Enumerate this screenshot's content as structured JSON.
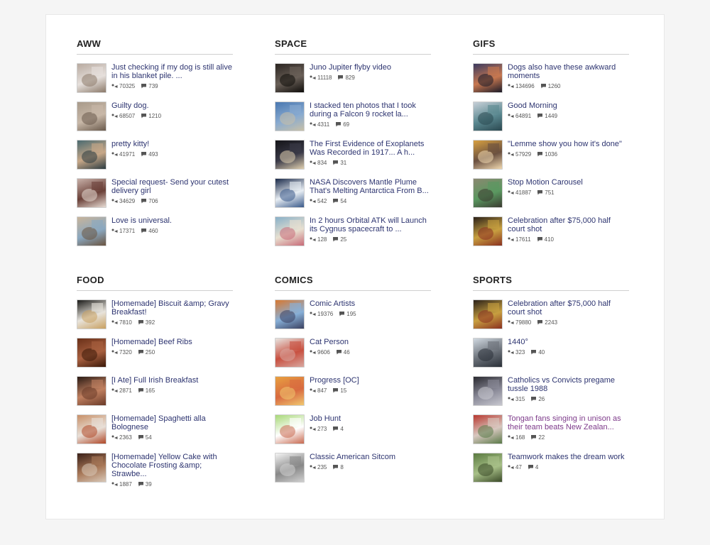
{
  "sections": [
    {
      "title": "AWW",
      "posts": [
        {
          "title": "Just checking if my dog is still alive in his blanket pile. ...",
          "score": "70325",
          "comments": "739",
          "thumb": [
            "#b8aaa0",
            "#e6e0dc",
            "#8c7a6a"
          ]
        },
        {
          "title": "Guilty dog.",
          "score": "68507",
          "comments": "1210",
          "thumb": [
            "#a89a8a",
            "#c8b8a8",
            "#6a5a4c"
          ]
        },
        {
          "title": "pretty kitty!",
          "score": "41971",
          "comments": "493",
          "thumb": [
            "#4a6a70",
            "#c8a888",
            "#2a3a40"
          ]
        },
        {
          "title": "Special request- Send your cutest delivery girl",
          "score": "34629",
          "comments": "706",
          "thumb": [
            "#c8b0a8",
            "#6a4038",
            "#e8dcd4"
          ]
        },
        {
          "title": "Love is universal.",
          "score": "17371",
          "comments": "460",
          "thumb": [
            "#c8b49a",
            "#8aa8c0",
            "#6a5440"
          ]
        }
      ]
    },
    {
      "title": "SPACE",
      "posts": [
        {
          "title": "Juno Jupiter flyby video",
          "score": "11118",
          "comments": "829",
          "thumb": [
            "#2a2420",
            "#6a6058",
            "#0e0c0a"
          ]
        },
        {
          "title": "I stacked ten photos that I took during a Falcon 9 rocket la...",
          "score": "4311",
          "comments": "69",
          "thumb": [
            "#4a78b0",
            "#88aad0",
            "#c8c0a8"
          ]
        },
        {
          "title": "The First Evidence of Exoplanets Was Recorded in 1917... A h...",
          "score": "834",
          "comments": "31",
          "thumb": [
            "#141418",
            "#3a3a48",
            "#e0d0b0"
          ]
        },
        {
          "title": "NASA Discovers Mantle Plume That's Melting Antarctica From B...",
          "score": "542",
          "comments": "54",
          "thumb": [
            "#1a2a4a",
            "#e8eef4",
            "#3a5a8a"
          ]
        },
        {
          "title": "In 2 hours Orbital ATK will Launch its Cygnus spacecraft to ...",
          "score": "128",
          "comments": "25",
          "thumb": [
            "#88b0c8",
            "#e8e0d0",
            "#c86a78"
          ]
        }
      ]
    },
    {
      "title": "GIFS",
      "posts": [
        {
          "title": "Dogs also have these awkward moments",
          "score": "134696",
          "comments": "1260",
          "thumb": [
            "#3a3a60",
            "#c87850",
            "#1a1a28"
          ]
        },
        {
          "title": "Good Morning",
          "score": "64891",
          "comments": "1449",
          "thumb": [
            "#c8d0d8",
            "#5a8890",
            "#2a4850"
          ]
        },
        {
          "title": "\"Lemme show you how it's done\"",
          "score": "57929",
          "comments": "1036",
          "thumb": [
            "#d8a040",
            "#6a5040",
            "#f0d8b0"
          ]
        },
        {
          "title": "Stop Motion Carousel",
          "score": "41887",
          "comments": "751",
          "thumb": [
            "#8a8870",
            "#5a9860",
            "#3a3a30"
          ]
        },
        {
          "title": "Celebration after $75,000 half court shot",
          "score": "17611",
          "comments": "410",
          "thumb": [
            "#2a2018",
            "#c8a040",
            "#8a3020"
          ]
        }
      ]
    },
    {
      "title": "FOOD",
      "posts": [
        {
          "title": "[Homemade] Biscuit &amp; Gravy Breakfast!",
          "score": "7810",
          "comments": "392",
          "thumb": [
            "#1a1a18",
            "#e8e4dc",
            "#c8a060"
          ]
        },
        {
          "title": "[Homemade] Beef Ribs",
          "score": "7320",
          "comments": "250",
          "thumb": [
            "#6a3018",
            "#a86040",
            "#3a1808"
          ]
        },
        {
          "title": "[I Ate] Full Irish Breakfast",
          "score": "2871",
          "comments": "165",
          "thumb": [
            "#2a1a14",
            "#c08060",
            "#6a3a28"
          ]
        },
        {
          "title": "[Homemade] Spaghetti alla Bolognese",
          "score": "2363",
          "comments": "54",
          "thumb": [
            "#c89068",
            "#e8e0d8",
            "#b04828"
          ]
        },
        {
          "title": "[Homemade] Yellow Cake with Chocolate Frosting &amp; Strawbe...",
          "score": "1887",
          "comments": "39",
          "thumb": [
            "#3a2018",
            "#a87858",
            "#d8c8b8"
          ]
        }
      ]
    },
    {
      "title": "COMICS",
      "posts": [
        {
          "title": "Comic Artists",
          "score": "19376",
          "comments": "195",
          "thumb": [
            "#d87830",
            "#88b0d8",
            "#3a4060"
          ]
        },
        {
          "title": "Cat Person",
          "score": "9606",
          "comments": "46",
          "thumb": [
            "#e8e4e0",
            "#c85040",
            "#d8a8a0"
          ]
        },
        {
          "title": "Progress [OC]",
          "score": "847",
          "comments": "15",
          "thumb": [
            "#e8a040",
            "#d86a40",
            "#f0c870"
          ]
        },
        {
          "title": "Job Hunt",
          "score": "273",
          "comments": "4",
          "thumb": [
            "#a8d878",
            "#ffffff",
            "#c86a50"
          ]
        },
        {
          "title": "Classic American Sitcom",
          "score": "235",
          "comments": "8",
          "thumb": [
            "#f4f4f4",
            "#888888",
            "#d0d0d0"
          ]
        }
      ]
    },
    {
      "title": "SPORTS",
      "posts": [
        {
          "title": "Celebration after $75,000 half court shot",
          "score": "79880",
          "comments": "2243",
          "thumb": [
            "#2a2018",
            "#c8a040",
            "#8a3020"
          ]
        },
        {
          "title": "1440°",
          "score": "323",
          "comments": "40",
          "thumb": [
            "#d0d8e0",
            "#6a7078",
            "#2a3038"
          ]
        },
        {
          "title": "Catholics vs Convicts pregame tussle 1988",
          "score": "315",
          "comments": "26",
          "thumb": [
            "#2a2a30",
            "#8a8a98",
            "#c8c8d0"
          ]
        },
        {
          "title": "Tongan fans singing in unison as their team beats New Zealan...",
          "score": "168",
          "comments": "22",
          "thumb": [
            "#b83830",
            "#d8c8c0",
            "#5a7a48"
          ],
          "visited": true
        },
        {
          "title": "Teamwork makes the dream work",
          "score": "47",
          "comments": "4",
          "thumb": [
            "#5a7a40",
            "#a8c088",
            "#3a4a28"
          ]
        }
      ]
    }
  ]
}
